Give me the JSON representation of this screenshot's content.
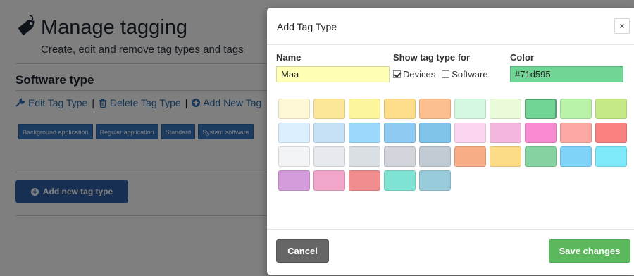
{
  "page": {
    "title": "Manage tagging",
    "subtitle": "Create, edit and remove tag types and tags",
    "section_title": "Software type",
    "links": {
      "edit": "Edit Tag Type",
      "delete": "Delete Tag Type",
      "add": "Add New Tag"
    },
    "tags": [
      "Background application",
      "Regular application",
      "Standard",
      "System software"
    ],
    "add_type_button": "Add new tag type"
  },
  "modal": {
    "title": "Add Tag Type",
    "close_label": "×",
    "name_label": "Name",
    "name_value": "Maa",
    "show_label": "Show tag type for",
    "devices_label": "Devices",
    "devices_checked": true,
    "software_label": "Software",
    "software_checked": false,
    "color_label": "Color",
    "color_value": "#71d595",
    "swatches": [
      "#fff8d6",
      "#fbe69a",
      "#fdf59b",
      "#fddc8a",
      "#fdbf8e",
      "#d4f9e1",
      "#eafbd9",
      "#71d595",
      "#b9f3a7",
      "#c6e889",
      "#dcefff",
      "#c6e1f6",
      "#9bd8fb",
      "#8fcaf2",
      "#80c4ea",
      "#fdd6f1",
      "#f3b7dd",
      "#f98bd0",
      "#fca9a3",
      "#f98182",
      "#f3f4f6",
      "#e6eaef",
      "#d9dfe2",
      "#d3d5dc",
      "#c1cbd3",
      "#f7ad85",
      "#fddb87",
      "#85d3a1",
      "#7fd3f9",
      "#7eeaf9",
      "#d49cdb",
      "#f0a5c9",
      "#f18d8f",
      "#7fe4d3",
      "#98ccdb"
    ],
    "selected_swatch": 7,
    "cancel_label": "Cancel",
    "save_label": "Save changes"
  }
}
